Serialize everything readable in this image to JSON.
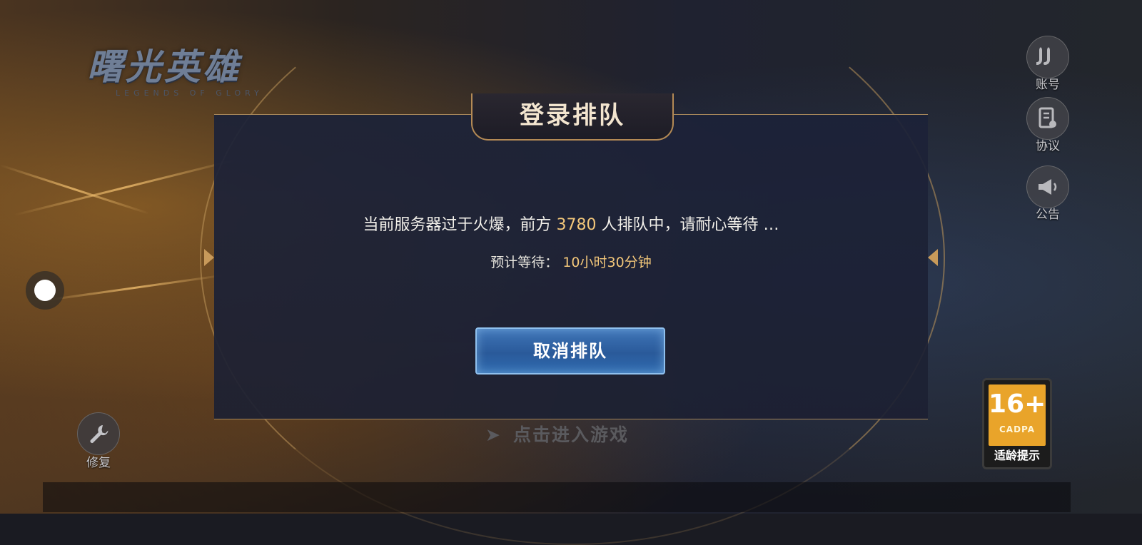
{
  "game": {
    "logo_title": "曙光英雄",
    "logo_subtitle": "LEGENDS OF GLORY"
  },
  "dialog": {
    "title": "登录排队",
    "message_prefix": "当前服务器过于火爆，前方",
    "queue_count": "3780",
    "message_suffix": "人排队中，请耐心等待 …",
    "estimate_label": "预计等待：",
    "estimate_value": "10小时30分钟",
    "cancel_label": "取消排队"
  },
  "side_menu": {
    "account_label": "账号",
    "agreement_label": "协议",
    "notice_label": "公告"
  },
  "repair_label": "修复",
  "enter_game_label": "点击进入游戏",
  "age_rating": {
    "number": "16+",
    "org": "CADPA",
    "tip": "适龄提示",
    "color": "#e9a42a"
  },
  "colors": {
    "highlight": "#f3c77a",
    "button_blue": "#2f6bb0",
    "gold_border": "#b48a55"
  }
}
